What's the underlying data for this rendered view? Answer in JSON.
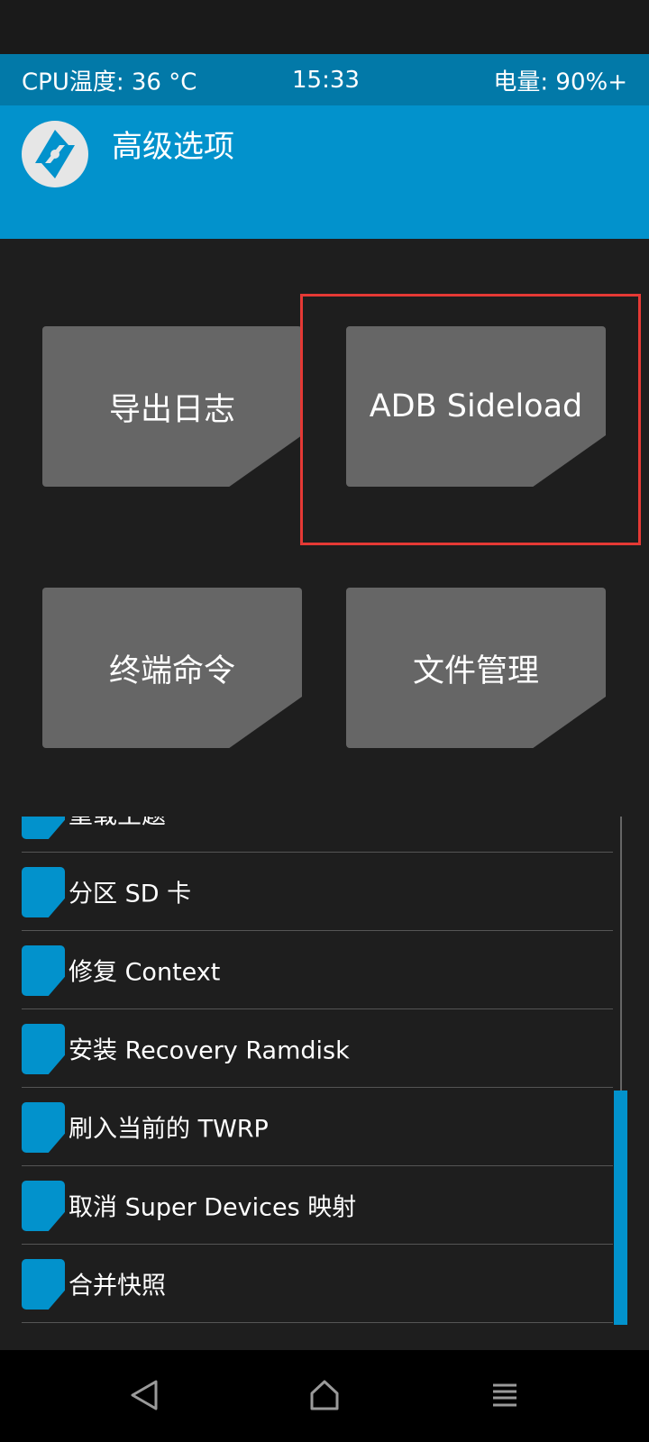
{
  "status_bar": {
    "cpu_temp": "CPU温度: 36 °C",
    "time": "15:33",
    "battery": "电量: 90%+"
  },
  "header": {
    "logo_icon": "twrp-logo-icon",
    "title": "高级选项"
  },
  "tiles": [
    {
      "label": "导出日志"
    },
    {
      "label": "ADB Sideload"
    },
    {
      "label": "终端命令"
    },
    {
      "label": "文件管理"
    }
  ],
  "list": {
    "items": [
      {
        "label": "重载主题"
      },
      {
        "label": "分区 SD 卡"
      },
      {
        "label": "修复 Context"
      },
      {
        "label": "安装 Recovery Ramdisk"
      },
      {
        "label": "刷入当前的 TWRP"
      },
      {
        "label": "取消 Super Devices 映射"
      },
      {
        "label": "合并快照"
      }
    ]
  },
  "navbar": {
    "back_icon": "back-triangle-icon",
    "home_icon": "home-icon",
    "menu_icon": "menu-icon"
  },
  "colors": {
    "accent": "#0292cc",
    "status_bar": "#0279a8",
    "tile": "#666666",
    "highlight": "#e53935",
    "background": "#1e1e1e"
  }
}
